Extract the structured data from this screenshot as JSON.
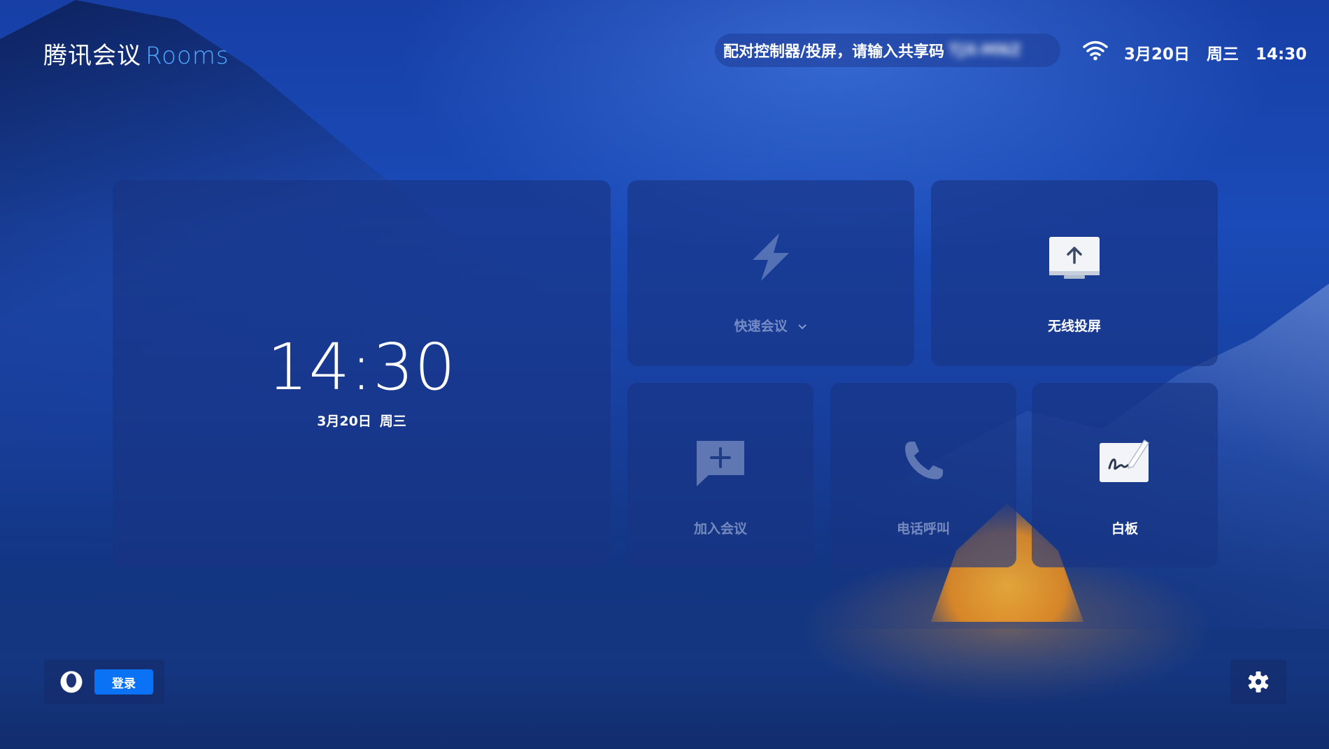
{
  "header": {
    "brand": "腾讯会议",
    "brand_suffix": "Rooms",
    "share_prompt": "配对控制器/投屏，请输入共享码",
    "share_code": "TJX-MNZ",
    "status": {
      "date": "3月20日",
      "weekday": "周三",
      "time": "14:30",
      "wifi_icon": "wifi-icon"
    }
  },
  "clock": {
    "time": "14:30",
    "date": "3月20日",
    "weekday": "周三"
  },
  "tiles": {
    "quick_meeting": {
      "label": "快速会议",
      "icon": "lightning-icon",
      "enabled": false
    },
    "wireless_cast": {
      "label": "无线投屏",
      "icon": "screen-cast-icon",
      "enabled": true
    },
    "join_meeting": {
      "label": "加入会议",
      "icon": "add-chat-icon",
      "enabled": false
    },
    "phone_call": {
      "label": "电话呼叫",
      "icon": "phone-icon",
      "enabled": false
    },
    "whiteboard": {
      "label": "白板",
      "icon": "whiteboard-icon",
      "enabled": true
    }
  },
  "footer": {
    "login_label": "登录",
    "avatar_icon": "avatar-icon",
    "settings_icon": "gear-icon"
  },
  "colors": {
    "accent": "#4fa9ff",
    "login_button": "#0a72f5",
    "tile_bg": "#18348e"
  }
}
